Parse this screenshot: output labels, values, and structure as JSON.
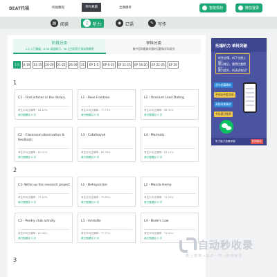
{
  "nav": {
    "brand": "BEAT托福",
    "links": [
      "托福教程",
      "单科真题",
      "全真模考"
    ],
    "active_index": 1,
    "buttons": [
      "智能规划",
      "微信登录"
    ]
  },
  "tabs": {
    "items": [
      "阅读",
      "听力",
      "口语",
      "写作"
    ],
    "active_index": 1
  },
  "categories": [
    {
      "title": "阶段分类",
      "subtitle": "1-5 入门基础，6-35 巩固练习，36 之后的用于测试和模考"
    },
    {
      "title": "学科分类",
      "subtitle": "集中容和最易听懂的话题和学科类别"
    }
  ],
  "chips": [
    "1-5",
    "6-10",
    "11-15",
    "16-20",
    "21-25",
    "26-30",
    "31",
    "EP 1-5",
    "EP 6-10",
    "EP 11-15",
    "EP 16-20",
    "EP 21-25",
    "EP 26"
  ],
  "groups": [
    {
      "number": "1",
      "cards": [
        {
          "title": "C1 - Find articles in the library",
          "score": "考生平均正确率：84.42%",
          "detail": "我已做题目 0 次"
        },
        {
          "title": "L1 - Rose Frantzen",
          "score": "考生平均正确率：77.75%",
          "detail": "我已做题目 0 次"
        },
        {
          "title": "L2 - Uranium Lead Dating",
          "score": "考生平均正确率：68.35%",
          "detail": "我已做题目 0 次"
        },
        {
          "title": "C2 - Classroom observation & feedback",
          "score": "考生平均正确率：85.01%",
          "detail": "我已做题目 0 次"
        },
        {
          "title": "L3 - Catalhoyuk",
          "score": "考生平均正确率：85.96%",
          "detail": "我已做题目 0 次"
        },
        {
          "title": "L4 - Marmots",
          "score": "考生平均正确率：83.12%",
          "detail": "我已做题目 0 次"
        }
      ]
    },
    {
      "number": "2",
      "cards": [
        {
          "title": "C1- Write up the research project",
          "score": "考生平均正确率：73.62%",
          "detail": "我已做题目 0 次"
        },
        {
          "title": "L1 - Behaviorism",
          "score": "考生平均正确率：79.85%",
          "detail": "我已做题目 0 次"
        },
        {
          "title": "L2 - Manila Hemp",
          "score": "考生平均正确率：74.55%",
          "detail": "我已做题目 0 次"
        },
        {
          "title": "C2 - Poetry club activity",
          "score": "考生平均正确率：82.06%",
          "detail": "我已做题目 0 次"
        },
        {
          "title": "L3 - Aristotle",
          "score": "考生平均正确率：77.77%",
          "detail": "我已做题目 0 次"
        },
        {
          "title": "L4 - Bode's Law",
          "score": "考生平均正确率：74.42%",
          "detail": "我已做题目 0 次"
        }
      ]
    },
    {
      "number": "3",
      "cards": []
    }
  ],
  "ad": {
    "title": "托福听力  单科突破",
    "bullets": [
      "听完全懂，听了也想上吗?",
      "笔记笔记，靠得住靠得住?",
      "能力提升，听读读笔记?"
    ],
    "tag1": "逐句逐篇精听",
    "tag2": "不同水平差异化",
    "tag3": "高频场景精讲",
    "tag4": "专注高分效率",
    "footer": "听力能力查看详细",
    "footer_btn": "扫码报名"
  },
  "watermark": {
    "name": "自动秒收录",
    "sub": "做上链接→来访一次→自动收录"
  },
  "colors": {
    "accent": "#1fa776",
    "ad_bg": "#4b54a0",
    "ad_yellow": "#f2c84b"
  }
}
